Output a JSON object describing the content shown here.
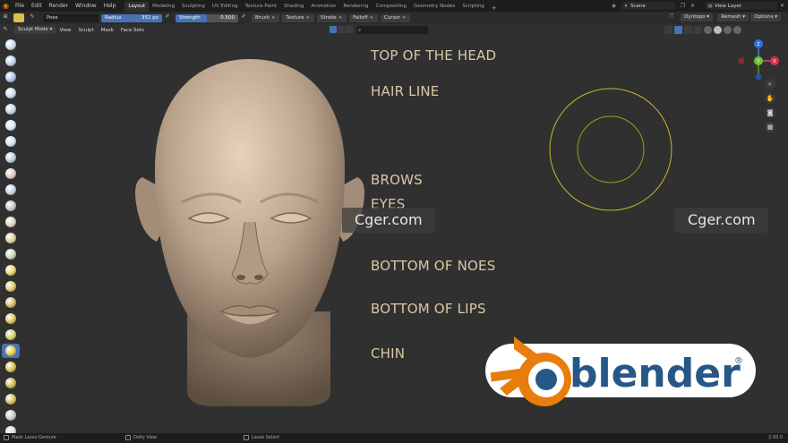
{
  "menu": {
    "items": [
      "File",
      "Edit",
      "Render",
      "Window",
      "Help"
    ],
    "workspaces": [
      "Layout",
      "Modeling",
      "Sculpting",
      "UV Editing",
      "Texture Paint",
      "Shading",
      "Animation",
      "Rendering",
      "Compositing",
      "Geometry Nodes",
      "Scripting"
    ],
    "active_workspace": "Layout",
    "add_workspace": "+",
    "scene": "Scene",
    "view_layer": "View Layer"
  },
  "tool_settings": {
    "brush_name": "Pose",
    "radius_label": "Radius",
    "radius_value": "351 px",
    "strength_label": "Strength",
    "strength_value": "0.500",
    "strength_fraction": 0.5,
    "dropdowns": [
      "Brush",
      "Texture",
      "Stroke",
      "Falloff",
      "Cursor"
    ],
    "dyntopo": "Dyntopo",
    "remesh": "Remesh",
    "options": "Options"
  },
  "header": {
    "mode": "Sculpt Mode",
    "menus": [
      "View",
      "Sculpt",
      "Mask",
      "Face Sets"
    ]
  },
  "guides": {
    "top_of_head": "TOP OF THE HEAD",
    "hair_line": "HAIR LINE",
    "brows": "BROWS",
    "eyes": "EYES",
    "bottom_of_nose": "BOTTOM OF NOES",
    "bottom_of_lips": "BOTTOM OF LIPS",
    "chin": "CHIN"
  },
  "watermarks": {
    "left": "Cger.com",
    "right": "Cger.com"
  },
  "logo": {
    "text": "blender",
    "registered": "®",
    "orange": "#e87d0d",
    "blue": "#265787"
  },
  "gizmo": {
    "x": "X",
    "y": "Y",
    "z": "Z"
  },
  "status": {
    "left": "Mask Lasso Gesture",
    "middle": "Dolly View",
    "right": "Lasso Select",
    "version": "2.93.0"
  },
  "colors": {
    "accent": "#4772b3",
    "brush_circle": "#c8b92a",
    "guide_text": "#d9c8a6",
    "skin": "#b8a28c"
  },
  "icons": {
    "tools": [
      "draw-icon",
      "draw-sharp-icon",
      "clay-icon",
      "clay-strips-icon",
      "clay-thumb-icon",
      "layer-icon",
      "inflate-icon",
      "blob-icon",
      "crease-icon",
      "smooth-icon",
      "flatten-icon",
      "fill-icon",
      "scrape-icon",
      "multiplane-scrape-icon",
      "pinch-icon",
      "grab-icon",
      "elastic-deform-icon",
      "snake-hook-icon",
      "thumb-icon",
      "pose-icon",
      "nudge-icon",
      "rotate-icon",
      "slide-relax-icon",
      "boundary-icon",
      "cloth-icon"
    ]
  }
}
